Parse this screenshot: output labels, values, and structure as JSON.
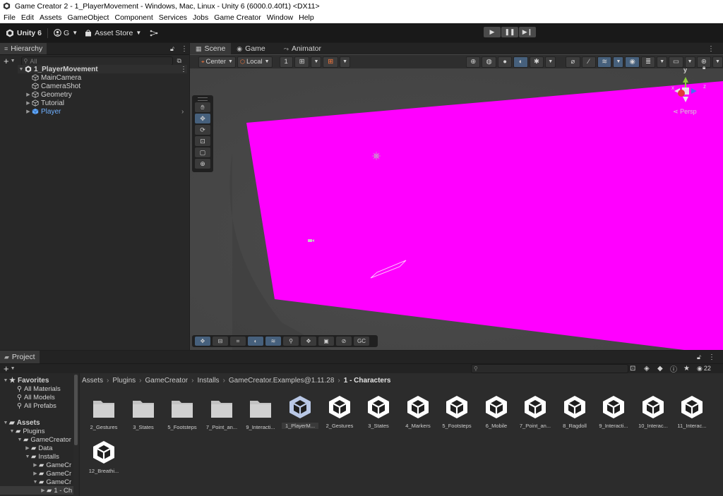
{
  "window": {
    "title": "Game Creator 2 - 1_PlayerMovement - Windows, Mac, Linux - Unity 6 (6000.0.40f1) <DX11>"
  },
  "menu": [
    "File",
    "Edit",
    "Assets",
    "GameObject",
    "Component",
    "Services",
    "Jobs",
    "Game Creator",
    "Window",
    "Help"
  ],
  "toolbar": {
    "account_label": "Unity 6",
    "user_initial": "G",
    "asset_store_label": "Asset Store"
  },
  "hierarchy": {
    "tab_label": "Hierarchy",
    "search_placeholder": "All",
    "scene_name": "1_PlayerMovement",
    "items": [
      "MainCamera",
      "CameraShot",
      "Geometry",
      "Tutorial",
      "Player"
    ]
  },
  "scene": {
    "tabs": [
      "Scene",
      "Game",
      "Animator"
    ],
    "pivot_label": "Center",
    "space_label": "Local",
    "grid_value": "1",
    "persp_label": "Persp",
    "gizmo_axes": {
      "y": "y",
      "x": "x",
      "z": "z"
    },
    "magenta": "#ff00ff",
    "overlay_gc_label": "GC"
  },
  "project": {
    "tab_label": "Project",
    "search_placeholder": "",
    "count_badge": "22",
    "favorites_label": "Favorites",
    "favorites": [
      "All Materials",
      "All Models",
      "All Prefabs"
    ],
    "assets_label": "Assets",
    "tree": [
      "Plugins",
      "GameCreator",
      "Data",
      "Installs",
      "GameCr",
      "GameCr",
      "GameCr",
      "1 - Ch"
    ],
    "breadcrumb": [
      "Assets",
      "Plugins",
      "GameCreator",
      "Installs",
      "GameCreator.Examples@1.11.28",
      "1 - Characters"
    ],
    "folders": [
      "2_Gestures",
      "3_States",
      "5_Footsteps",
      "7_Point_an...",
      "9_Interacti..."
    ],
    "scenes": [
      "1_PlayerM...",
      "2_Gestures",
      "3_States",
      "4_Markers",
      "5_Footsteps",
      "6_Mobile",
      "7_Point_an...",
      "8_Ragdoll",
      "9_Interacti...",
      "10_Interac...",
      "11_Interac...",
      "12_Breathi..."
    ]
  }
}
